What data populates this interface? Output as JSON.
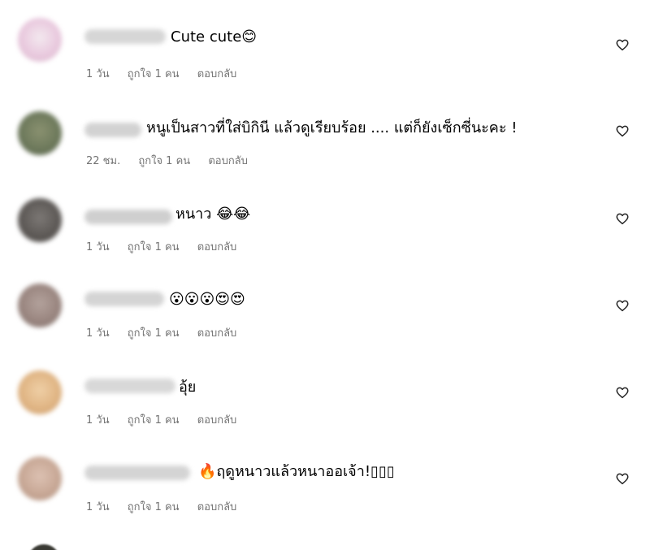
{
  "comments": [
    {
      "text": "Cute cute😊",
      "time": "1 วัน",
      "likes": "ถูกใจ 1 คน",
      "reply": "ตอบกลับ",
      "avatar_color": "#e9c9de",
      "name_color": "#d6d6d6"
    },
    {
      "text": "หนูเป็นสาวที่ใส่บิกินี แล้วดูเรียบร้อย .... แต่ก็ยังเซ็กซี่นะคะ !",
      "time": "22 ชม.",
      "likes": "ถูกใจ 1 คน",
      "reply": "ตอบกลับ",
      "avatar_color": "#6e7a5c",
      "name_color": "#d2d2d2"
    },
    {
      "text": "หนาว 😂😂",
      "time": "1 วัน",
      "likes": "ถูกใจ 1 คน",
      "reply": "ตอบกลับ",
      "avatar_color": "#5e5a57",
      "name_color": "#cfcfcf"
    },
    {
      "text": "😮😮😮😍😍",
      "time": "1 วัน",
      "likes": "ถูกใจ 1 คน",
      "reply": "ตอบกลับ",
      "avatar_color": "#9a8680",
      "name_color": "#d4d4d4"
    },
    {
      "text": "อุ้ย",
      "time": "1 วัน",
      "likes": "ถูกใจ 1 คน",
      "reply": "ตอบกลับ",
      "avatar_color": "#e0b584",
      "name_color": "#d8d8d8"
    },
    {
      "text": "🔥ฤดูหนาวแล้วหนาออเจ้า!▯▯▯",
      "time": "1 วัน",
      "likes": "ถูกใจ 1 คน",
      "reply": "ตอบกลับ",
      "avatar_color": "#c8a896",
      "name_color": "#d4d4d4"
    }
  ],
  "heart_icon": "heart-outline-icon"
}
